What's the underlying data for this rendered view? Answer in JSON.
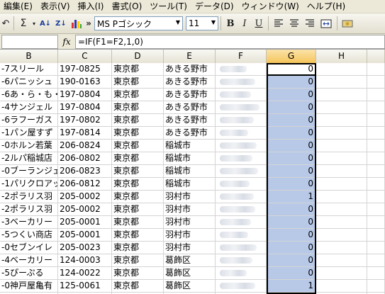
{
  "menu": [
    {
      "label": "編集(E)"
    },
    {
      "label": "表示(V)"
    },
    {
      "label": "挿入(I)"
    },
    {
      "label": "書式(O)"
    },
    {
      "label": "ツール(T)"
    },
    {
      "label": "データ(D)"
    },
    {
      "label": "ウィンドウ(W)"
    },
    {
      "label": "ヘルプ(H)"
    }
  ],
  "toolbar": {
    "undo_glyph": "↶",
    "sum_glyph": "Σ",
    "sort_asc_glyph": "A↓",
    "sort_desc_glyph": "Z↓",
    "more_glyph": "»",
    "font_name": "MS Pゴシック",
    "font_size": "11",
    "bold": "B",
    "italic": "I",
    "underline": "U"
  },
  "formula_bar": {
    "fx": "fx",
    "formula": "=IF(F1=F2,1,0)"
  },
  "columns": [
    "B",
    "C",
    "D",
    "E",
    "F",
    "G",
    "H"
  ],
  "rows": [
    {
      "b": "-7スリール",
      "c": "197-0825",
      "d": "東京都",
      "e": "あきる野市",
      "g": "0"
    },
    {
      "b": "-6パニッシュ",
      "c": "190-0163",
      "d": "東京都",
      "e": "あきる野市",
      "g": "0"
    },
    {
      "b": "-6あ・ら・も・",
      "c": "197-0804",
      "d": "東京都",
      "e": "あきる野市",
      "g": "0"
    },
    {
      "b": "-4サンジェル",
      "c": "197-0804",
      "d": "東京都",
      "e": "あきる野市",
      "g": "0"
    },
    {
      "b": "-6ラフーガス",
      "c": "197-0802",
      "d": "東京都",
      "e": "あきる野市",
      "g": "0"
    },
    {
      "b": "-1パン屋すず",
      "c": "197-0814",
      "d": "東京都",
      "e": "あきる野市",
      "g": "0"
    },
    {
      "b": "-0ホルン若葉",
      "c": "206-0824",
      "d": "東京都",
      "e": "稲城市",
      "g": "0"
    },
    {
      "b": "-2ルパ稲城店",
      "c": "206-0802",
      "d": "東京都",
      "e": "稲城市",
      "g": "0"
    },
    {
      "b": "-0ブーランジェ",
      "c": "206-0823",
      "d": "東京都",
      "e": "稲城市",
      "g": "0"
    },
    {
      "b": "-1パリクロアッ",
      "c": "206-0812",
      "d": "東京都",
      "e": "稲城市",
      "g": "0"
    },
    {
      "b": "-2ポラリス羽",
      "c": "205-0002",
      "d": "東京都",
      "e": "羽村市",
      "g": "1"
    },
    {
      "b": "-2ポラリス羽",
      "c": "205-0002",
      "d": "東京都",
      "e": "羽村市",
      "g": "0"
    },
    {
      "b": "-3ベーカリー",
      "c": "205-0001",
      "d": "東京都",
      "e": "羽村市",
      "g": "0"
    },
    {
      "b": "-5つくい商店",
      "c": "205-0001",
      "d": "東京都",
      "e": "羽村市",
      "g": "0"
    },
    {
      "b": "-0セブンイレ",
      "c": "205-0023",
      "d": "東京都",
      "e": "羽村市",
      "g": "0"
    },
    {
      "b": "-4ベーカリー",
      "c": "124-0003",
      "d": "東京都",
      "e": "葛飾区",
      "g": "0"
    },
    {
      "b": "-5ぴーぷる",
      "c": "124-0022",
      "d": "東京都",
      "e": "葛飾区",
      "g": "0"
    },
    {
      "b": "-0神戸屋亀有",
      "c": "125-0061",
      "d": "東京都",
      "e": "葛飾区",
      "g": "1"
    }
  ]
}
